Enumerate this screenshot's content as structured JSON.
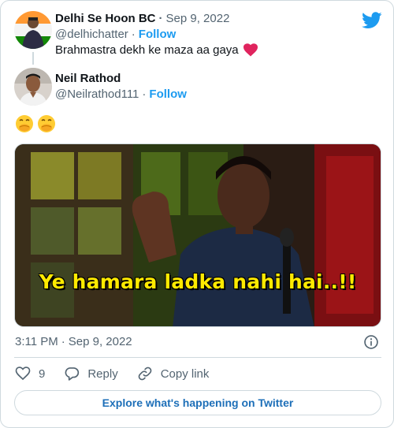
{
  "quoted_tweet": {
    "display_name": "Delhi Se Hoon BC",
    "date": "Sep 9, 2022",
    "handle": "@delhichatter",
    "follow_label": "Follow",
    "text": "Brahmastra dekh ke maza aa gaya"
  },
  "main_tweet": {
    "display_name": "Neil Rathod",
    "handle": "@Neilrathod111",
    "follow_label": "Follow",
    "emojis": [
      "face-with-hand-over-mouth",
      "face-with-hand-over-mouth"
    ],
    "media_caption": "Ye hamara ladka nahi hai..!!",
    "time": "3:11 PM",
    "date": "Sep 9, 2022"
  },
  "actions": {
    "like_count": "9",
    "reply_label": "Reply",
    "copy_link_label": "Copy link"
  },
  "explore_label": "Explore what's happening on Twitter",
  "colors": {
    "twitter_blue": "#1d9bf0",
    "heart_red": "#e0245e",
    "text_secondary": "#536471"
  }
}
